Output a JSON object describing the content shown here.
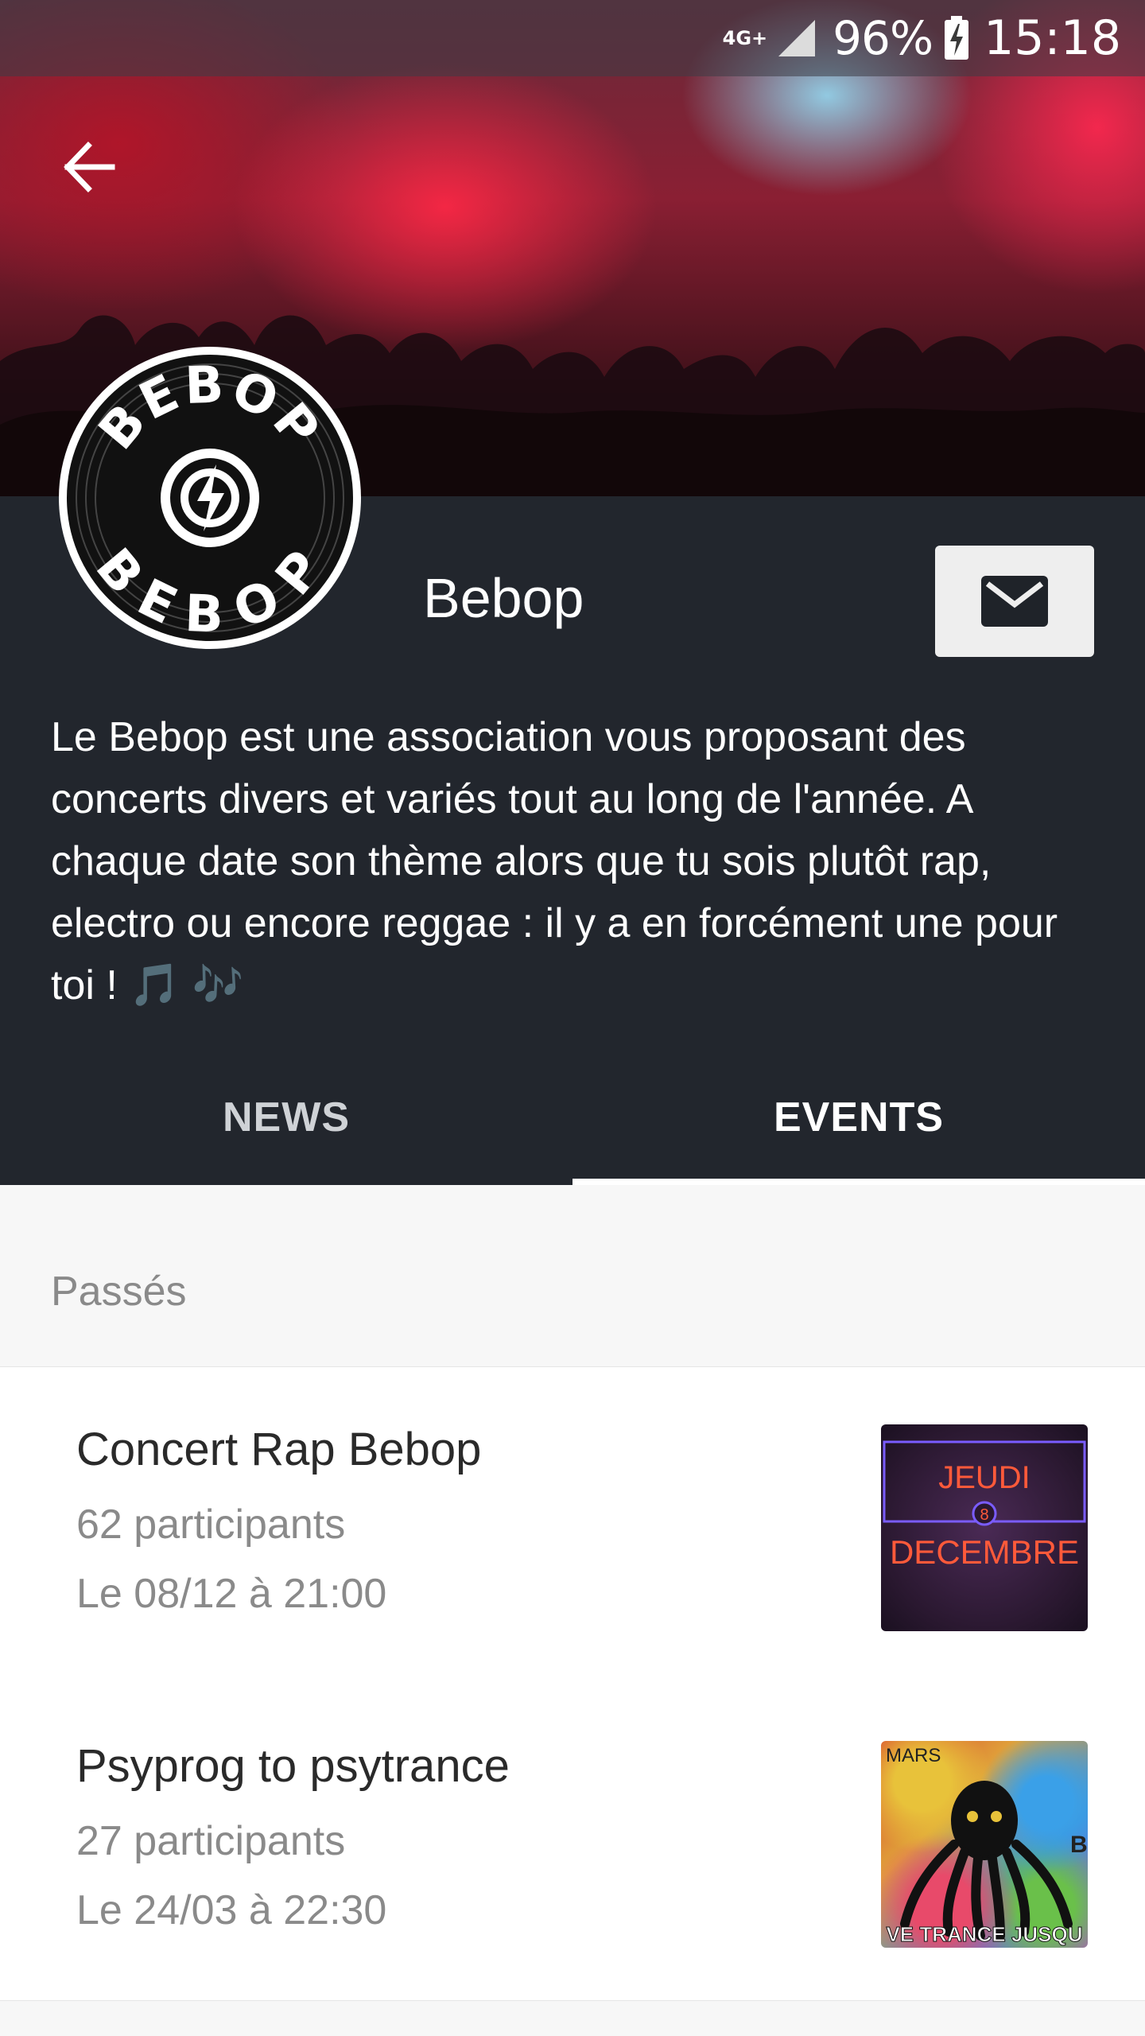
{
  "status_bar": {
    "network": "4G+",
    "battery_percent": "96%",
    "time": "15:18"
  },
  "header": {
    "back_icon": "arrow-left-icon"
  },
  "logo": {
    "text_top": "BEBOP",
    "text_bottom": "BEBOP"
  },
  "organization": {
    "name": "Bebop",
    "description": "Le Bebop est une association vous proposant des concerts divers et variés tout au long de l'année. A chaque date son thème alors que tu sois plutôt rap, electro ou encore reggae : il y a en forcément une pour toi ! 🎵 🎶",
    "mail_icon": "envelope-icon"
  },
  "tabs": [
    {
      "label": "NEWS",
      "active": false
    },
    {
      "label": "EVENTS",
      "active": true
    }
  ],
  "events_section": {
    "label": "Passés",
    "items": [
      {
        "title": "Concert Rap Bebop",
        "participants": "62 participants",
        "date": "Le 08/12 à 21:00",
        "thumb_line1": "JEUDI",
        "thumb_day": "8",
        "thumb_line2": "DECEMBRE"
      },
      {
        "title": "Psyprog to psytrance",
        "participants": "27 participants",
        "date": "Le 24/03 à 22:30",
        "thumb_top": "MARS",
        "thumb_right": "B",
        "thumb_bottom": "VE TRANCE JUSQU"
      }
    ]
  },
  "colors": {
    "header_bg": "#22262d",
    "accent": "#ffffff",
    "secondary_text": "#8a8a8a"
  }
}
